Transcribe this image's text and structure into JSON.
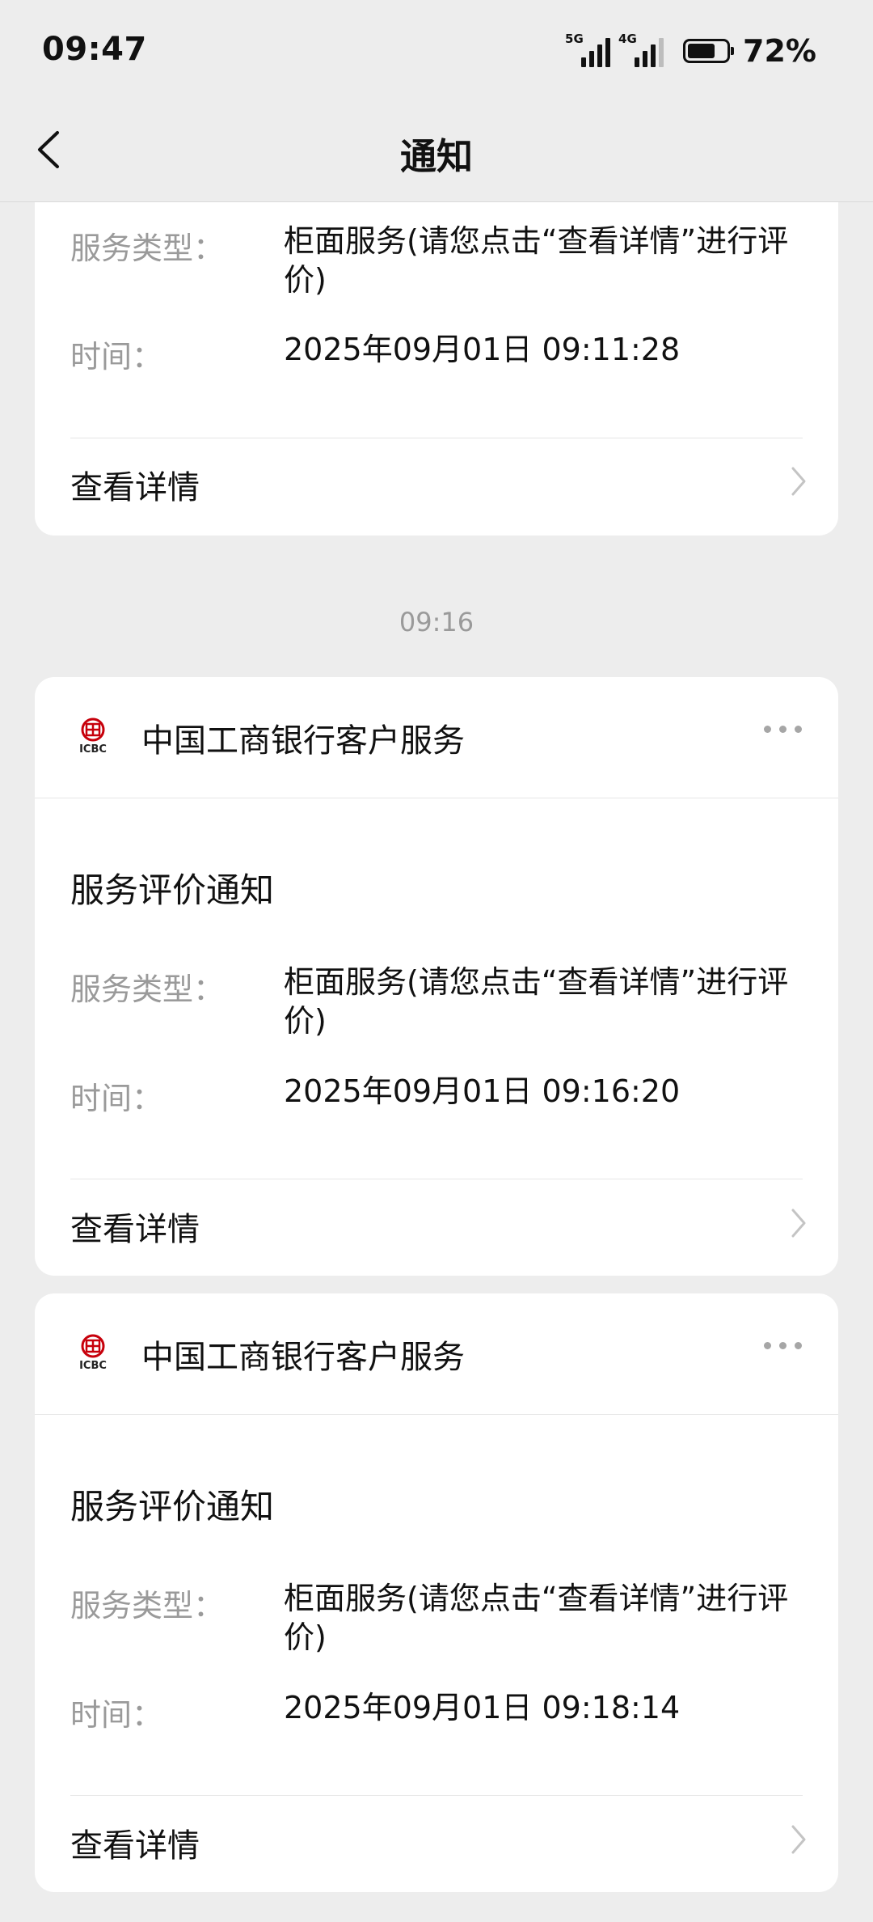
{
  "status_bar": {
    "time": "09:47",
    "network1": "5G",
    "network2": "4G",
    "battery_level": 0.72,
    "battery_text": "72%"
  },
  "nav": {
    "title": "通知"
  },
  "messages": [
    {
      "service_label": "服务类型：",
      "service_value": "柜面服务(请您点击“查看详情”进行评价)",
      "time_label": "时间：",
      "time_value": "2025年09月01日 09:11:28",
      "detail_label": "查看详情"
    },
    {
      "timestamp": "09:16",
      "sender": "中国工商银行客户服务",
      "logo_text": "ICBC",
      "title": "服务评价通知",
      "service_label": "服务类型：",
      "service_value": "柜面服务(请您点击“查看详情”进行评价)",
      "time_label": "时间：",
      "time_value": "2025年09月01日 09:16:20",
      "detail_label": "查看详情"
    },
    {
      "sender": "中国工商银行客户服务",
      "logo_text": "ICBC",
      "title": "服务评价通知",
      "service_label": "服务类型：",
      "service_value": "柜面服务(请您点击“查看详情”进行评价)",
      "time_label": "时间：",
      "time_value": "2025年09月01日 09:18:14",
      "detail_label": "查看详情"
    }
  ],
  "colors": {
    "background": "#ededed",
    "card": "#ffffff",
    "label_gray": "#9a9a9a",
    "brand_red": "#c7000b"
  },
  "icons": {
    "back": "chevron-left-icon",
    "more": "more-dots-icon",
    "chevron": "chevron-right-icon",
    "logo": "icbc-logo-icon"
  }
}
